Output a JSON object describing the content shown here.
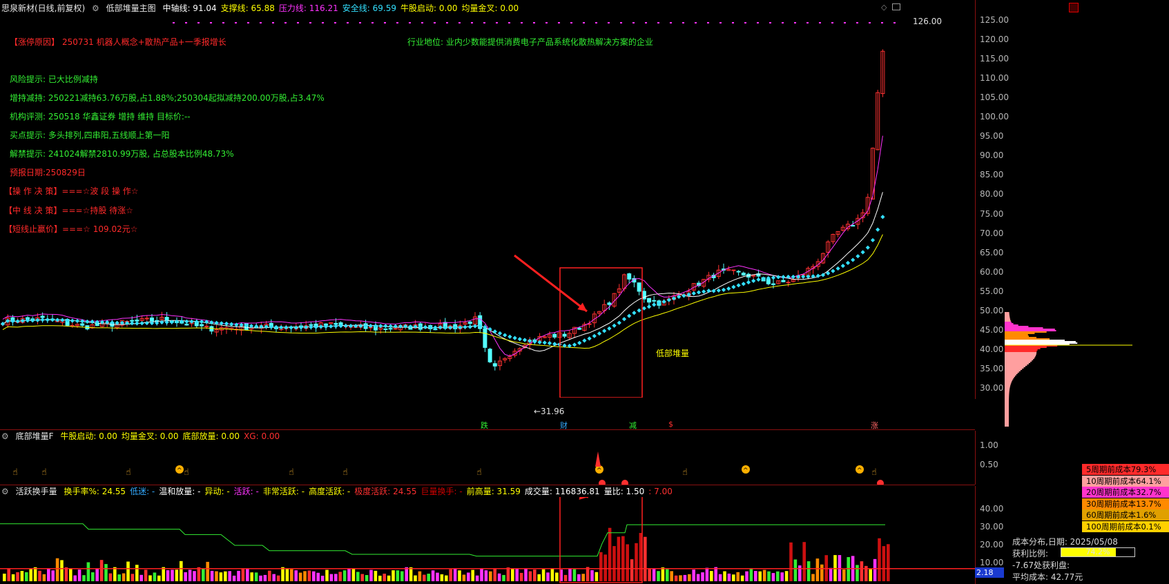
{
  "main_header": {
    "stock": "思泉新材(日线,前复权)",
    "indicator": "低部堆量主图",
    "items": [
      {
        "text": "中轴线: 91.04",
        "color": "#ffffff"
      },
      {
        "text": "支撑线: 65.88",
        "color": "#ffff00"
      },
      {
        "text": "压力线: 116.21",
        "color": "#ff33ff"
      },
      {
        "text": "安全线: 69.59",
        "color": "#33e0ff"
      },
      {
        "text": "牛股启动: 0.00",
        "color": "#ffff00"
      },
      {
        "text": "均量金叉: 0.00",
        "color": "#ffff00"
      }
    ]
  },
  "annotations": {
    "reason_label": "【涨停原因】",
    "reason": "250731 机器人概念+散热产品+一季报增长",
    "industry": "行业地位: 业内少数能提供消费电子产品系统化散热解决方案的企业",
    "risk": "风险提示: 已大比例减持",
    "holding": "增持减持: 250221减持63.76万股,占1.88%;250304起拟减持200.00万股,占3.47%",
    "rating": "机构评测: 250518 华鑫证券 增持 维持 目标价:--",
    "buy_hint": "买点提示: 多头排列,四串阳,五线顺上第一阳",
    "unlock": "解禁提示: 241024解禁2810.99万股, 占总股本比例48.73%",
    "forecast": "预报日期:250829日",
    "op_decision": "【操 作 决 策】===☆波 段 操 作☆",
    "mid_decision": "【中 线 决 策】===☆持股 待涨☆",
    "stop_price": "【短线止赢价】===☆ 109.02元☆",
    "bottom_label": "低部堆量",
    "low_label": "←31.96",
    "high_label": "126.00"
  },
  "event_markers": [
    "跌",
    "财",
    "减",
    "$",
    "涨"
  ],
  "price_axis": [
    "125.00",
    "120.00",
    "115.00",
    "110.00",
    "105.00",
    "100.00",
    "95.00",
    "90.00",
    "85.00",
    "80.00",
    "75.00",
    "70.00",
    "65.00",
    "60.00",
    "55.00",
    "50.00",
    "45.00",
    "40.00",
    "35.00",
    "30.00"
  ],
  "sub1_header": {
    "name": "底部堆量F",
    "items": [
      {
        "text": "牛股启动: 0.00",
        "color": "#ffff00"
      },
      {
        "text": "均量金叉: 0.00",
        "color": "#ffff00"
      },
      {
        "text": "底部放量: 0.00",
        "color": "#ffff00"
      },
      {
        "text": "XG: 0.00",
        "color": "#ff3030"
      }
    ]
  },
  "sub1_axis": [
    "1.00",
    "0.50"
  ],
  "sub2_header": {
    "name": "活跃换手量",
    "items": [
      {
        "text": "换手率%: 24.55",
        "color": "#ffff00"
      },
      {
        "text": "低迷: -",
        "color": "#33aaff"
      },
      {
        "text": "温和放量: -",
        "color": "#ffffff"
      },
      {
        "text": "异动: -",
        "color": "#ffff00"
      },
      {
        "text": "活跃: -",
        "color": "#ff33ff"
      },
      {
        "text": "非常活跃: -",
        "color": "#ffff00"
      },
      {
        "text": "高度活跃: -",
        "color": "#ffff00"
      },
      {
        "text": "极度活跃: 24.55",
        "color": "#ff3030"
      },
      {
        "text": "巨量换手: -",
        "color": "#cc0000"
      },
      {
        "text": "前高量: 31.59",
        "color": "#ffff00"
      },
      {
        "text": "成交量: 116836.81",
        "color": "#ffffff"
      },
      {
        "text": "量比: 1.50",
        "color": "#ffffff"
      },
      {
        "text": ": 7.00",
        "color": "#ff3030"
      }
    ]
  },
  "sub2_axis": [
    "40.00",
    "30.00",
    "20.00",
    "10.00"
  ],
  "sub2_value_tag": "2.18",
  "cost_distribution": [
    {
      "label": "5周期前成本79.3%",
      "color": "#ff2a2a"
    },
    {
      "label": "10周期前成本64.1%",
      "color": "#ff9f9f"
    },
    {
      "label": "20周期前成本32.7%",
      "color": "#ff33cc"
    },
    {
      "label": "30周期前成本13.7%",
      "color": "#ff8a00"
    },
    {
      "label": "60周期前成本1.6%",
      "color": "#e0a000"
    },
    {
      "label": "100周期前成本0.1%",
      "color": "#ffd000"
    }
  ],
  "cost_info": {
    "date_line": "成本分布,日期: 2025/05/08",
    "profit_label": "获利比例:",
    "profit_value": "74.2%",
    "profit_fraction": 0.742,
    "profit_note": "-7.67处获利盘:",
    "avg_cost": "平均成本: 42.77元"
  },
  "colors": {
    "up": "#ff3232",
    "down": "#54ffff",
    "sma": "#ff33ff",
    "mid": "#ffffff",
    "support": "#ffff00",
    "dots": "#33e0ff",
    "border": "#8a1010"
  }
}
